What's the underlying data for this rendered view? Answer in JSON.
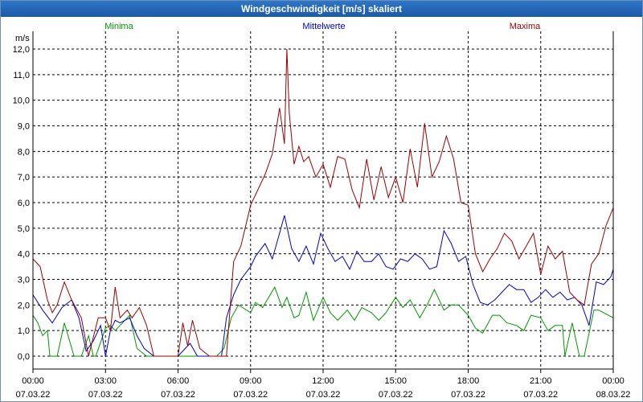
{
  "window": {
    "title": "Windgeschwindigkeit [m/s] skaliert"
  },
  "chart_data": {
    "type": "line",
    "title": "Windgeschwindigkeit [m/s] skaliert",
    "ylabel": "m/s",
    "xlabel": "",
    "ylim": [
      0,
      12
    ],
    "xlim_hours": [
      0,
      24
    ],
    "grid": true,
    "legend_placement": "top",
    "y_ticks": [
      "0,0",
      "1,0",
      "2,0",
      "3,0",
      "4,0",
      "5,0",
      "6,0",
      "7,0",
      "8,0",
      "9,0",
      "10,0",
      "11,0",
      "12,0"
    ],
    "x_ticks": [
      {
        "time": "00:00",
        "date": "07.03.22"
      },
      {
        "time": "03:00",
        "date": "07.03.22"
      },
      {
        "time": "06:00",
        "date": "07.03.22"
      },
      {
        "time": "09:00",
        "date": "07.03.22"
      },
      {
        "time": "12:00",
        "date": "07.03.22"
      },
      {
        "time": "15:00",
        "date": "07.03.22"
      },
      {
        "time": "18:00",
        "date": "07.03.22"
      },
      {
        "time": "21:00",
        "date": "07.03.22"
      },
      {
        "time": "00:00",
        "date": "08.03.22"
      }
    ],
    "series": [
      {
        "name": "Minima",
        "color": "#009900",
        "x": [
          0,
          0.2,
          0.4,
          0.6,
          0.7,
          1.0,
          1.3,
          1.7,
          2.0,
          2.3,
          2.5,
          2.6,
          3.0,
          3.2,
          3.4,
          4.0,
          4.3,
          4.7,
          5.0,
          5.5,
          6.0,
          6.4,
          6.8,
          7.2,
          7.5,
          7.6,
          7.9,
          8.2,
          8.5,
          9.0,
          9.2,
          9.5,
          10.0,
          10.3,
          10.5,
          10.8,
          11.0,
          11.3,
          11.6,
          12.0,
          12.3,
          12.6,
          13.0,
          13.3,
          13.6,
          14.0,
          14.3,
          14.6,
          15.0,
          15.3,
          15.6,
          16.0,
          16.3,
          16.6,
          17.0,
          17.3,
          17.6,
          18.0,
          18.3,
          18.6,
          19.0,
          19.3,
          19.6,
          20.0,
          20.3,
          20.6,
          21.0,
          21.3,
          21.6,
          21.9,
          22.0,
          22.3,
          22.6,
          22.8,
          23.0,
          23.2,
          23.4,
          23.6,
          24.0
        ],
        "values": [
          1.6,
          1.3,
          0.8,
          1.0,
          0,
          0,
          1.3,
          0,
          0,
          0.8,
          0,
          0,
          1.1,
          1.2,
          1.0,
          1.6,
          0.3,
          0,
          0,
          0,
          0,
          0,
          0,
          0,
          0,
          0,
          0.3,
          1.5,
          2.0,
          1.7,
          2.1,
          1.9,
          2.7,
          1.9,
          2.3,
          1.5,
          1.6,
          2.5,
          1.4,
          2.3,
          1.7,
          1.4,
          1.8,
          1.4,
          1.9,
          1.7,
          1.4,
          1.7,
          2.3,
          1.9,
          2.2,
          1.5,
          2.0,
          2.6,
          1.8,
          2.0,
          2.0,
          1.6,
          1.1,
          0.9,
          1.6,
          1.6,
          1.3,
          1.2,
          1.0,
          1.6,
          1.5,
          1.0,
          1.2,
          1.2,
          0,
          1.3,
          0,
          0,
          0.9,
          1.8,
          1.8,
          1.7,
          1.5
        ]
      },
      {
        "name": "Mittelwerte",
        "color": "#0000cc",
        "x": [
          0,
          0.4,
          0.8,
          1.2,
          1.6,
          1.9,
          2.2,
          2.5,
          2.8,
          3.0,
          3.2,
          3.4,
          3.6,
          4.0,
          4.3,
          4.6,
          5.0,
          5.5,
          6.0,
          6.3,
          6.5,
          6.8,
          7.2,
          7.5,
          7.8,
          8.0,
          8.3,
          8.6,
          9.0,
          9.2,
          9.6,
          9.9,
          10.2,
          10.4,
          10.7,
          11.0,
          11.3,
          11.6,
          11.9,
          12.2,
          12.5,
          12.8,
          13.1,
          13.4,
          13.7,
          14.0,
          14.3,
          14.6,
          14.9,
          15.2,
          15.5,
          15.8,
          16.1,
          16.4,
          16.7,
          17.0,
          17.3,
          17.6,
          17.9,
          18.2,
          18.5,
          18.8,
          19.1,
          19.4,
          19.7,
          20.0,
          20.3,
          20.6,
          20.9,
          21.2,
          21.5,
          21.8,
          22.1,
          22.4,
          22.7,
          23.0,
          23.3,
          23.6,
          23.9,
          24.0
        ],
        "values": [
          2.4,
          1.8,
          1.3,
          1.9,
          2.2,
          1.5,
          0.2,
          0.6,
          1.2,
          0,
          1.0,
          1.4,
          1.3,
          1.5,
          0.8,
          0.3,
          0,
          0,
          0,
          0.3,
          0.5,
          0,
          0,
          0,
          0,
          1.5,
          2.4,
          3.0,
          3.5,
          3.9,
          4.4,
          3.8,
          4.8,
          5.5,
          4.2,
          3.7,
          4.3,
          3.6,
          4.8,
          4.2,
          3.7,
          3.9,
          3.4,
          4.1,
          3.7,
          3.7,
          4.0,
          3.5,
          3.4,
          3.8,
          3.7,
          4.0,
          3.8,
          3.4,
          3.5,
          4.9,
          4.4,
          3.7,
          3.9,
          2.8,
          2.1,
          2.0,
          2.2,
          2.5,
          2.8,
          2.6,
          2.6,
          2.1,
          2.3,
          2.6,
          2.3,
          2.5,
          2.2,
          2.3,
          2.0,
          1.2,
          2.9,
          2.8,
          3.1,
          3.4
        ]
      },
      {
        "name": "Maxima",
        "color": "#990000",
        "x": [
          0,
          0.3,
          0.6,
          0.8,
          1.0,
          1.3,
          1.6,
          2.0,
          2.3,
          2.7,
          3.0,
          3.2,
          3.4,
          3.6,
          3.9,
          4.1,
          4.4,
          4.7,
          5.0,
          5.4,
          5.8,
          6.0,
          6.2,
          6.4,
          6.6,
          6.9,
          7.3,
          7.7,
          8.0,
          8.3,
          8.6,
          9.0,
          9.3,
          9.6,
          9.9,
          10.2,
          10.4,
          10.5,
          10.6,
          10.8,
          11.0,
          11.2,
          11.4,
          11.7,
          12.0,
          12.3,
          12.6,
          12.9,
          13.2,
          13.5,
          13.8,
          14.1,
          14.4,
          14.7,
          15.0,
          15.3,
          15.6,
          15.9,
          16.2,
          16.5,
          16.8,
          17.1,
          17.4,
          17.7,
          18.0,
          18.3,
          18.6,
          18.9,
          19.2,
          19.5,
          19.8,
          20.1,
          20.4,
          20.7,
          21.0,
          21.3,
          21.6,
          21.9,
          22.2,
          22.5,
          22.8,
          23.1,
          23.4,
          23.7,
          24.0
        ],
        "values": [
          3.8,
          3.5,
          2.2,
          1.7,
          2.0,
          2.9,
          2.2,
          1.5,
          0,
          1.5,
          1.5,
          1.0,
          2.7,
          1.5,
          1.8,
          1.5,
          1.9,
          1.2,
          0,
          0,
          0,
          0,
          1.3,
          0.4,
          1.4,
          0.3,
          0,
          0,
          0,
          3.7,
          4.3,
          5.9,
          6.5,
          7.1,
          7.9,
          9.7,
          8.3,
          12.0,
          9.5,
          7.5,
          8.2,
          7.6,
          7.8,
          7.0,
          7.5,
          6.6,
          7.8,
          7.7,
          6.5,
          5.8,
          7.7,
          6.1,
          7.4,
          6.2,
          7.0,
          6.0,
          8.1,
          6.6,
          9.1,
          7.0,
          7.6,
          8.6,
          7.7,
          6.0,
          5.9,
          4.0,
          3.3,
          3.8,
          4.2,
          4.8,
          4.5,
          3.8,
          4.3,
          4.8,
          3.2,
          4.3,
          3.8,
          4.1,
          2.5,
          2.2,
          2.0,
          3.6,
          4.0,
          5.1,
          5.8
        ]
      }
    ]
  }
}
